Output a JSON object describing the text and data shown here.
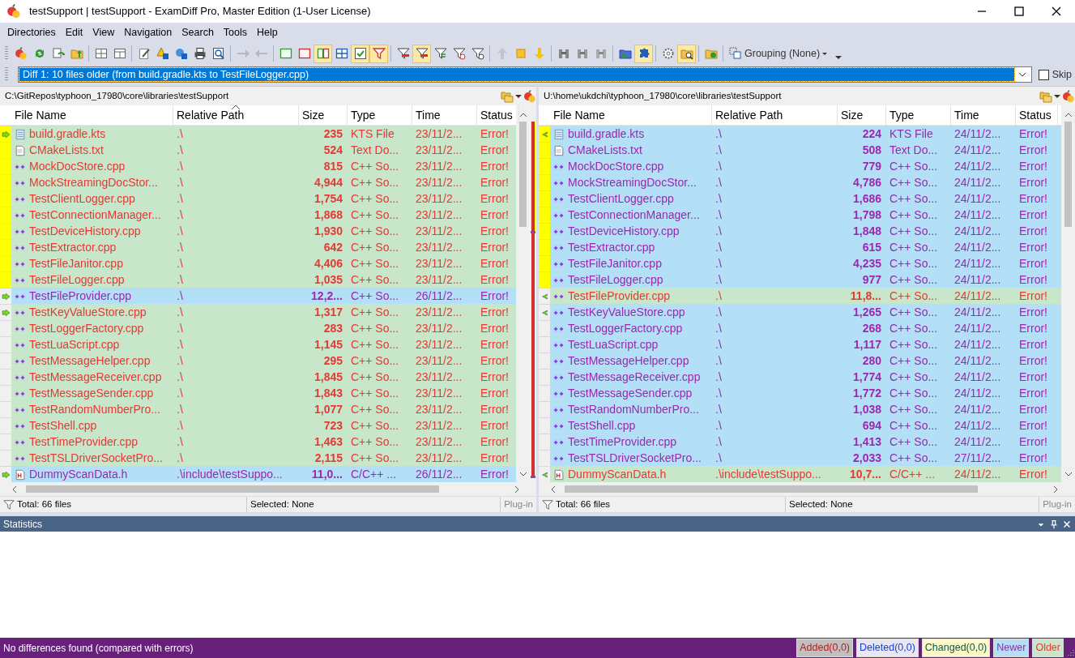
{
  "window": {
    "title": "testSupport | testSupport - ExamDiff Pro, Master Edition (1-User License)"
  },
  "menu": [
    {
      "label": "Directories"
    },
    {
      "label": "Edit"
    },
    {
      "label": "View"
    },
    {
      "label": "Navigation"
    },
    {
      "label": "Search"
    },
    {
      "label": "Tools"
    },
    {
      "label": "Help"
    }
  ],
  "toolbar": {
    "groups": [
      [
        {
          "pressed": false,
          "disabled": false
        },
        {
          "pressed": false,
          "disabled": false
        },
        {
          "pressed": false,
          "disabled": false
        },
        {
          "pressed": false,
          "disabled": false
        }
      ],
      [
        {
          "pressed": false,
          "disabled": false
        },
        {
          "pressed": false,
          "disabled": false
        }
      ],
      [
        {
          "pressed": false,
          "disabled": false
        },
        {
          "pressed": false,
          "disabled": false
        },
        {
          "pressed": false,
          "disabled": false
        },
        {
          "pressed": false,
          "disabled": false
        },
        {
          "pressed": false,
          "disabled": false
        }
      ],
      [
        {
          "pressed": false,
          "disabled": true
        },
        {
          "pressed": false,
          "disabled": true
        }
      ],
      [
        {
          "pressed": false,
          "disabled": false
        },
        {
          "pressed": false,
          "disabled": false
        },
        {
          "pressed": true,
          "disabled": false
        },
        {
          "pressed": false,
          "disabled": false
        },
        {
          "pressed": true,
          "disabled": false
        },
        {
          "pressed": true,
          "disabled": false
        }
      ],
      [
        {
          "pressed": false,
          "disabled": false
        },
        {
          "pressed": true,
          "disabled": false
        },
        {
          "pressed": false,
          "disabled": false
        },
        {
          "pressed": false,
          "disabled": false
        },
        {
          "pressed": false,
          "disabled": false
        }
      ],
      [
        {
          "pressed": false,
          "disabled": true
        },
        {
          "pressed": false,
          "disabled": false
        },
        {
          "pressed": false,
          "disabled": false
        }
      ],
      [
        {
          "pressed": false,
          "disabled": false
        },
        {
          "pressed": false,
          "disabled": false
        },
        {
          "pressed": false,
          "disabled": false
        }
      ],
      [
        {
          "pressed": false,
          "disabled": false
        },
        {
          "pressed": true,
          "disabled": false
        }
      ],
      [
        {
          "pressed": false,
          "disabled": false
        },
        {
          "pressed": true,
          "disabled": false
        }
      ],
      [
        {
          "pressed": false,
          "disabled": false
        }
      ]
    ],
    "grouping": {
      "label": "Grouping (None)"
    }
  },
  "diff_selector": {
    "value": "Diff 1: 10 files older (from build.gradle.kts to TestFileLogger.cpp)",
    "skip": {
      "label": "Skip",
      "checked": false
    }
  },
  "panes": [
    {
      "path": "C:\\GitRepos\\typhoon_17980\\core\\libraries\\testSupport",
      "columns": [
        {
          "label": "File Name",
          "sorted": false
        },
        {
          "label": "Relative Path",
          "sorted": true
        },
        {
          "label": "Size",
          "sorted": false
        },
        {
          "label": "Type",
          "sorted": false
        },
        {
          "label": "Time",
          "sorted": false
        },
        {
          "label": "Status",
          "sorted": false
        }
      ],
      "rows": [
        {
          "name": "build.gradle.kts",
          "rel_path": ".\\",
          "size": "235",
          "type": "KTS File",
          "time": "23/11/2...",
          "status": "Error!",
          "newer": false,
          "kind": "text",
          "arrow": true,
          "in_diff": true
        },
        {
          "name": "CMakeLists.txt",
          "rel_path": ".\\",
          "size": "524",
          "type": "Text Do...",
          "time": "23/11/2...",
          "status": "Error!",
          "newer": false,
          "kind": "plain",
          "arrow": false,
          "in_diff": true
        },
        {
          "name": "MockDocStore.cpp",
          "rel_path": ".\\",
          "size": "815",
          "type": "C++ So...",
          "time": "23/11/2...",
          "status": "Error!",
          "newer": false,
          "kind": "cpp",
          "arrow": false,
          "in_diff": true
        },
        {
          "name": "MockStreamingDocStor...",
          "rel_path": ".\\",
          "size": "4,944",
          "type": "C++ So...",
          "time": "23/11/2...",
          "status": "Error!",
          "newer": false,
          "kind": "cpp",
          "arrow": false,
          "in_diff": true
        },
        {
          "name": "TestClientLogger.cpp",
          "rel_path": ".\\",
          "size": "1,754",
          "type": "C++ So...",
          "time": "23/11/2...",
          "status": "Error!",
          "newer": false,
          "kind": "cpp",
          "arrow": false,
          "in_diff": true
        },
        {
          "name": "TestConnectionManager...",
          "rel_path": ".\\",
          "size": "1,868",
          "type": "C++ So...",
          "time": "23/11/2...",
          "status": "Error!",
          "newer": false,
          "kind": "cpp",
          "arrow": false,
          "in_diff": true
        },
        {
          "name": "TestDeviceHistory.cpp",
          "rel_path": ".\\",
          "size": "1,930",
          "type": "C++ So...",
          "time": "23/11/2...",
          "status": "Error!",
          "newer": false,
          "kind": "cpp",
          "arrow": false,
          "in_diff": true
        },
        {
          "name": "TestExtractor.cpp",
          "rel_path": ".\\",
          "size": "642",
          "type": "C++ So...",
          "time": "23/11/2...",
          "status": "Error!",
          "newer": false,
          "kind": "cpp",
          "arrow": false,
          "in_diff": true
        },
        {
          "name": "TestFileJanitor.cpp",
          "rel_path": ".\\",
          "size": "4,406",
          "type": "C++ So...",
          "time": "23/11/2...",
          "status": "Error!",
          "newer": false,
          "kind": "cpp",
          "arrow": false,
          "in_diff": true
        },
        {
          "name": "TestFileLogger.cpp",
          "rel_path": ".\\",
          "size": "1,035",
          "type": "C++ So...",
          "time": "23/11/2...",
          "status": "Error!",
          "newer": false,
          "kind": "cpp",
          "arrow": false,
          "in_diff": true
        },
        {
          "name": "TestFileProvider.cpp",
          "rel_path": ".\\",
          "size": "12,2...",
          "type": "C++ So...",
          "time": "26/11/2...",
          "status": "Error!",
          "newer": true,
          "kind": "cpp",
          "arrow": true,
          "in_diff": false
        },
        {
          "name": "TestKeyValueStore.cpp",
          "rel_path": ".\\",
          "size": "1,317",
          "type": "C++ So...",
          "time": "23/11/2...",
          "status": "Error!",
          "newer": false,
          "kind": "cpp",
          "arrow": true,
          "in_diff": false
        },
        {
          "name": "TestLoggerFactory.cpp",
          "rel_path": ".\\",
          "size": "283",
          "type": "C++ So...",
          "time": "23/11/2...",
          "status": "Error!",
          "newer": false,
          "kind": "cpp",
          "arrow": false,
          "in_diff": false
        },
        {
          "name": "TestLuaScript.cpp",
          "rel_path": ".\\",
          "size": "1,145",
          "type": "C++ So...",
          "time": "23/11/2...",
          "status": "Error!",
          "newer": false,
          "kind": "cpp",
          "arrow": false,
          "in_diff": false
        },
        {
          "name": "TestMessageHelper.cpp",
          "rel_path": ".\\",
          "size": "295",
          "type": "C++ So...",
          "time": "23/11/2...",
          "status": "Error!",
          "newer": false,
          "kind": "cpp",
          "arrow": false,
          "in_diff": false
        },
        {
          "name": "TestMessageReceiver.cpp",
          "rel_path": ".\\",
          "size": "1,845",
          "type": "C++ So...",
          "time": "23/11/2...",
          "status": "Error!",
          "newer": false,
          "kind": "cpp",
          "arrow": false,
          "in_diff": false
        },
        {
          "name": "TestMessageSender.cpp",
          "rel_path": ".\\",
          "size": "1,843",
          "type": "C++ So...",
          "time": "23/11/2...",
          "status": "Error!",
          "newer": false,
          "kind": "cpp",
          "arrow": false,
          "in_diff": false
        },
        {
          "name": "TestRandomNumberPro...",
          "rel_path": ".\\",
          "size": "1,077",
          "type": "C++ So...",
          "time": "23/11/2...",
          "status": "Error!",
          "newer": false,
          "kind": "cpp",
          "arrow": false,
          "in_diff": false
        },
        {
          "name": "TestShell.cpp",
          "rel_path": ".\\",
          "size": "723",
          "type": "C++ So...",
          "time": "23/11/2...",
          "status": "Error!",
          "newer": false,
          "kind": "cpp",
          "arrow": false,
          "in_diff": false
        },
        {
          "name": "TestTimeProvider.cpp",
          "rel_path": ".\\",
          "size": "1,463",
          "type": "C++ So...",
          "time": "23/11/2...",
          "status": "Error!",
          "newer": false,
          "kind": "cpp",
          "arrow": false,
          "in_diff": false
        },
        {
          "name": "TestTSLDriverSocketPro...",
          "rel_path": ".\\",
          "size": "2,115",
          "type": "C++ So...",
          "time": "23/11/2...",
          "status": "Error!",
          "newer": false,
          "kind": "cpp",
          "arrow": false,
          "in_diff": false
        },
        {
          "name": "DummyScanData.h",
          "rel_path": ".\\include\\testSuppo...",
          "size": "11,0...",
          "type": "C/C++ ...",
          "time": "26/11/2...",
          "status": "Error!",
          "newer": true,
          "kind": "header",
          "arrow": true,
          "in_diff": false
        }
      ],
      "footer": {
        "total": "Total: 66 files",
        "selected": "Selected: None",
        "plugin": "Plug-in"
      }
    },
    {
      "path": "U:\\home\\ukdchi\\typhoon_17980\\core\\libraries\\testSupport",
      "columns": [
        {
          "label": "File Name",
          "sorted": false
        },
        {
          "label": "Relative Path",
          "sorted": false
        },
        {
          "label": "Size",
          "sorted": false
        },
        {
          "label": "Type",
          "sorted": false
        },
        {
          "label": "Time",
          "sorted": false
        },
        {
          "label": "Status",
          "sorted": false
        }
      ],
      "rows": [
        {
          "name": "build.gradle.kts",
          "rel_path": ".\\",
          "size": "224",
          "type": "KTS File",
          "time": "24/11/2...",
          "status": "Error!",
          "newer": true,
          "kind": "text",
          "arrow": true,
          "in_diff": true
        },
        {
          "name": "CMakeLists.txt",
          "rel_path": ".\\",
          "size": "508",
          "type": "Text Do...",
          "time": "24/11/2...",
          "status": "Error!",
          "newer": true,
          "kind": "plain",
          "arrow": false,
          "in_diff": true
        },
        {
          "name": "MockDocStore.cpp",
          "rel_path": ".\\",
          "size": "779",
          "type": "C++ So...",
          "time": "24/11/2...",
          "status": "Error!",
          "newer": true,
          "kind": "cpp",
          "arrow": false,
          "in_diff": true
        },
        {
          "name": "MockStreamingDocStor...",
          "rel_path": ".\\",
          "size": "4,786",
          "type": "C++ So...",
          "time": "24/11/2...",
          "status": "Error!",
          "newer": true,
          "kind": "cpp",
          "arrow": false,
          "in_diff": true
        },
        {
          "name": "TestClientLogger.cpp",
          "rel_path": ".\\",
          "size": "1,686",
          "type": "C++ So...",
          "time": "24/11/2...",
          "status": "Error!",
          "newer": true,
          "kind": "cpp",
          "arrow": false,
          "in_diff": true
        },
        {
          "name": "TestConnectionManager...",
          "rel_path": ".\\",
          "size": "1,798",
          "type": "C++ So...",
          "time": "24/11/2...",
          "status": "Error!",
          "newer": true,
          "kind": "cpp",
          "arrow": false,
          "in_diff": true
        },
        {
          "name": "TestDeviceHistory.cpp",
          "rel_path": ".\\",
          "size": "1,848",
          "type": "C++ So...",
          "time": "24/11/2...",
          "status": "Error!",
          "newer": true,
          "kind": "cpp",
          "arrow": false,
          "in_diff": true
        },
        {
          "name": "TestExtractor.cpp",
          "rel_path": ".\\",
          "size": "615",
          "type": "C++ So...",
          "time": "24/11/2...",
          "status": "Error!",
          "newer": true,
          "kind": "cpp",
          "arrow": false,
          "in_diff": true
        },
        {
          "name": "TestFileJanitor.cpp",
          "rel_path": ".\\",
          "size": "4,235",
          "type": "C++ So...",
          "time": "24/11/2...",
          "status": "Error!",
          "newer": true,
          "kind": "cpp",
          "arrow": false,
          "in_diff": true
        },
        {
          "name": "TestFileLogger.cpp",
          "rel_path": ".\\",
          "size": "977",
          "type": "C++ So...",
          "time": "24/11/2...",
          "status": "Error!",
          "newer": true,
          "kind": "cpp",
          "arrow": false,
          "in_diff": true
        },
        {
          "name": "TestFileProvider.cpp",
          "rel_path": ".\\",
          "size": "11,8...",
          "type": "C++ So...",
          "time": "24/11/2...",
          "status": "Error!",
          "newer": false,
          "kind": "cpp",
          "arrow": true,
          "in_diff": false
        },
        {
          "name": "TestKeyValueStore.cpp",
          "rel_path": ".\\",
          "size": "1,265",
          "type": "C++ So...",
          "time": "24/11/2...",
          "status": "Error!",
          "newer": true,
          "kind": "cpp",
          "arrow": true,
          "in_diff": false
        },
        {
          "name": "TestLoggerFactory.cpp",
          "rel_path": ".\\",
          "size": "268",
          "type": "C++ So...",
          "time": "24/11/2...",
          "status": "Error!",
          "newer": true,
          "kind": "cpp",
          "arrow": false,
          "in_diff": false
        },
        {
          "name": "TestLuaScript.cpp",
          "rel_path": ".\\",
          "size": "1,117",
          "type": "C++ So...",
          "time": "24/11/2...",
          "status": "Error!",
          "newer": true,
          "kind": "cpp",
          "arrow": false,
          "in_diff": false
        },
        {
          "name": "TestMessageHelper.cpp",
          "rel_path": ".\\",
          "size": "280",
          "type": "C++ So...",
          "time": "24/11/2...",
          "status": "Error!",
          "newer": true,
          "kind": "cpp",
          "arrow": false,
          "in_diff": false
        },
        {
          "name": "TestMessageReceiver.cpp",
          "rel_path": ".\\",
          "size": "1,774",
          "type": "C++ So...",
          "time": "24/11/2...",
          "status": "Error!",
          "newer": true,
          "kind": "cpp",
          "arrow": false,
          "in_diff": false
        },
        {
          "name": "TestMessageSender.cpp",
          "rel_path": ".\\",
          "size": "1,772",
          "type": "C++ So...",
          "time": "24/11/2...",
          "status": "Error!",
          "newer": true,
          "kind": "cpp",
          "arrow": false,
          "in_diff": false
        },
        {
          "name": "TestRandomNumberPro...",
          "rel_path": ".\\",
          "size": "1,038",
          "type": "C++ So...",
          "time": "24/11/2...",
          "status": "Error!",
          "newer": true,
          "kind": "cpp",
          "arrow": false,
          "in_diff": false
        },
        {
          "name": "TestShell.cpp",
          "rel_path": ".\\",
          "size": "694",
          "type": "C++ So...",
          "time": "24/11/2...",
          "status": "Error!",
          "newer": true,
          "kind": "cpp",
          "arrow": false,
          "in_diff": false
        },
        {
          "name": "TestTimeProvider.cpp",
          "rel_path": ".\\",
          "size": "1,413",
          "type": "C++ So...",
          "time": "24/11/2...",
          "status": "Error!",
          "newer": true,
          "kind": "cpp",
          "arrow": false,
          "in_diff": false
        },
        {
          "name": "TestTSLDriverSocketPro...",
          "rel_path": ".\\",
          "size": "2,033",
          "type": "C++ So...",
          "time": "27/11/2...",
          "status": "Error!",
          "newer": true,
          "kind": "cpp",
          "arrow": false,
          "in_diff": false
        },
        {
          "name": "DummyScanData.h",
          "rel_path": ".\\include\\testSuppo...",
          "size": "10,7...",
          "type": "C/C++ ...",
          "time": "24/11/2...",
          "status": "Error!",
          "newer": false,
          "kind": "header",
          "arrow": true,
          "in_diff": false
        }
      ],
      "footer": {
        "total": "Total: 66 files",
        "selected": "Selected: None",
        "plugin": "Plug-in"
      }
    }
  ],
  "statistics": {
    "title": "Statistics"
  },
  "status_bar": {
    "message": "No differences found (compared with errors)",
    "legend": [
      {
        "label": "Added(0,0)",
        "kind": "added"
      },
      {
        "label": "Deleted(0,0)",
        "kind": "deleted"
      },
      {
        "label": "Changed(0,0)",
        "kind": "changed"
      },
      {
        "label": "Newer",
        "kind": "newer"
      },
      {
        "label": "Older",
        "kind": "older"
      }
    ]
  }
}
